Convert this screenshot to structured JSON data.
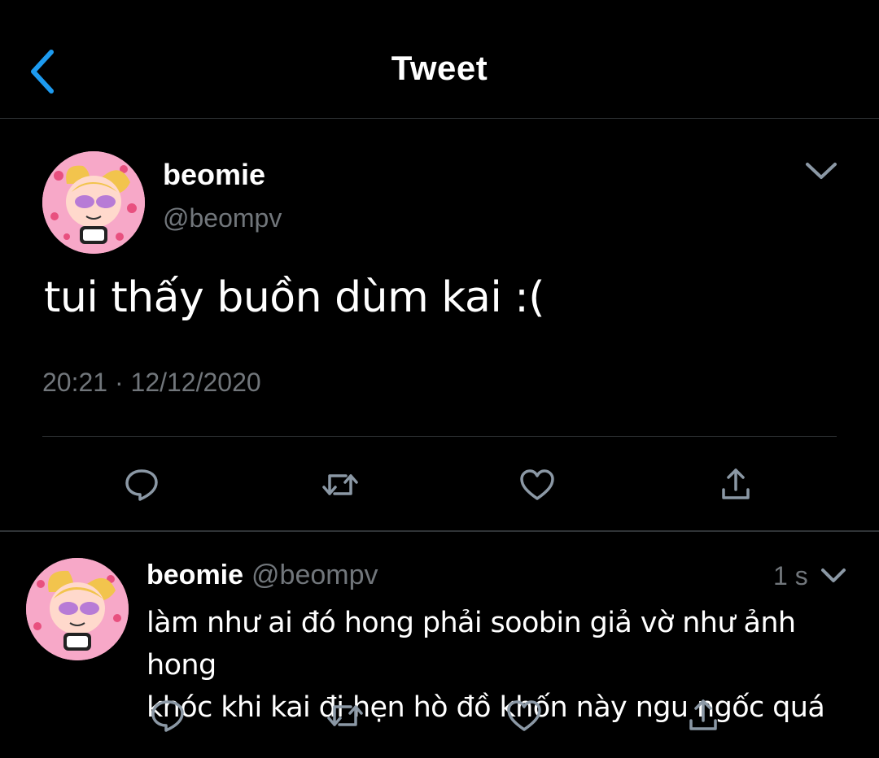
{
  "header": {
    "title": "Tweet",
    "back_icon": "chevron-left-icon",
    "accent_color": "#1d9bf0"
  },
  "main_tweet": {
    "display_name": "beomie",
    "handle": "@beompv",
    "text": "tui thấy buồn dùm kai :(",
    "timestamp": "20:21 · 12/12/2020",
    "icons": [
      "reply-icon",
      "retweet-icon",
      "like-icon",
      "share-icon"
    ]
  },
  "reply_tweet": {
    "display_name": "beomie",
    "handle": "@beompv",
    "time": "1 s",
    "text_line1": "làm như ai đó hong phải soobin giả vờ như ảnh hong",
    "text_line2": "khóc khi kai đi hẹn hò đồ khốn này ngu ngốc quá",
    "icons": [
      "reply-icon",
      "retweet-icon",
      "like-icon",
      "share-icon"
    ]
  },
  "colors": {
    "background": "#000000",
    "text_primary": "#ffffff",
    "text_secondary": "#71767b",
    "divider": "#2f3336"
  }
}
